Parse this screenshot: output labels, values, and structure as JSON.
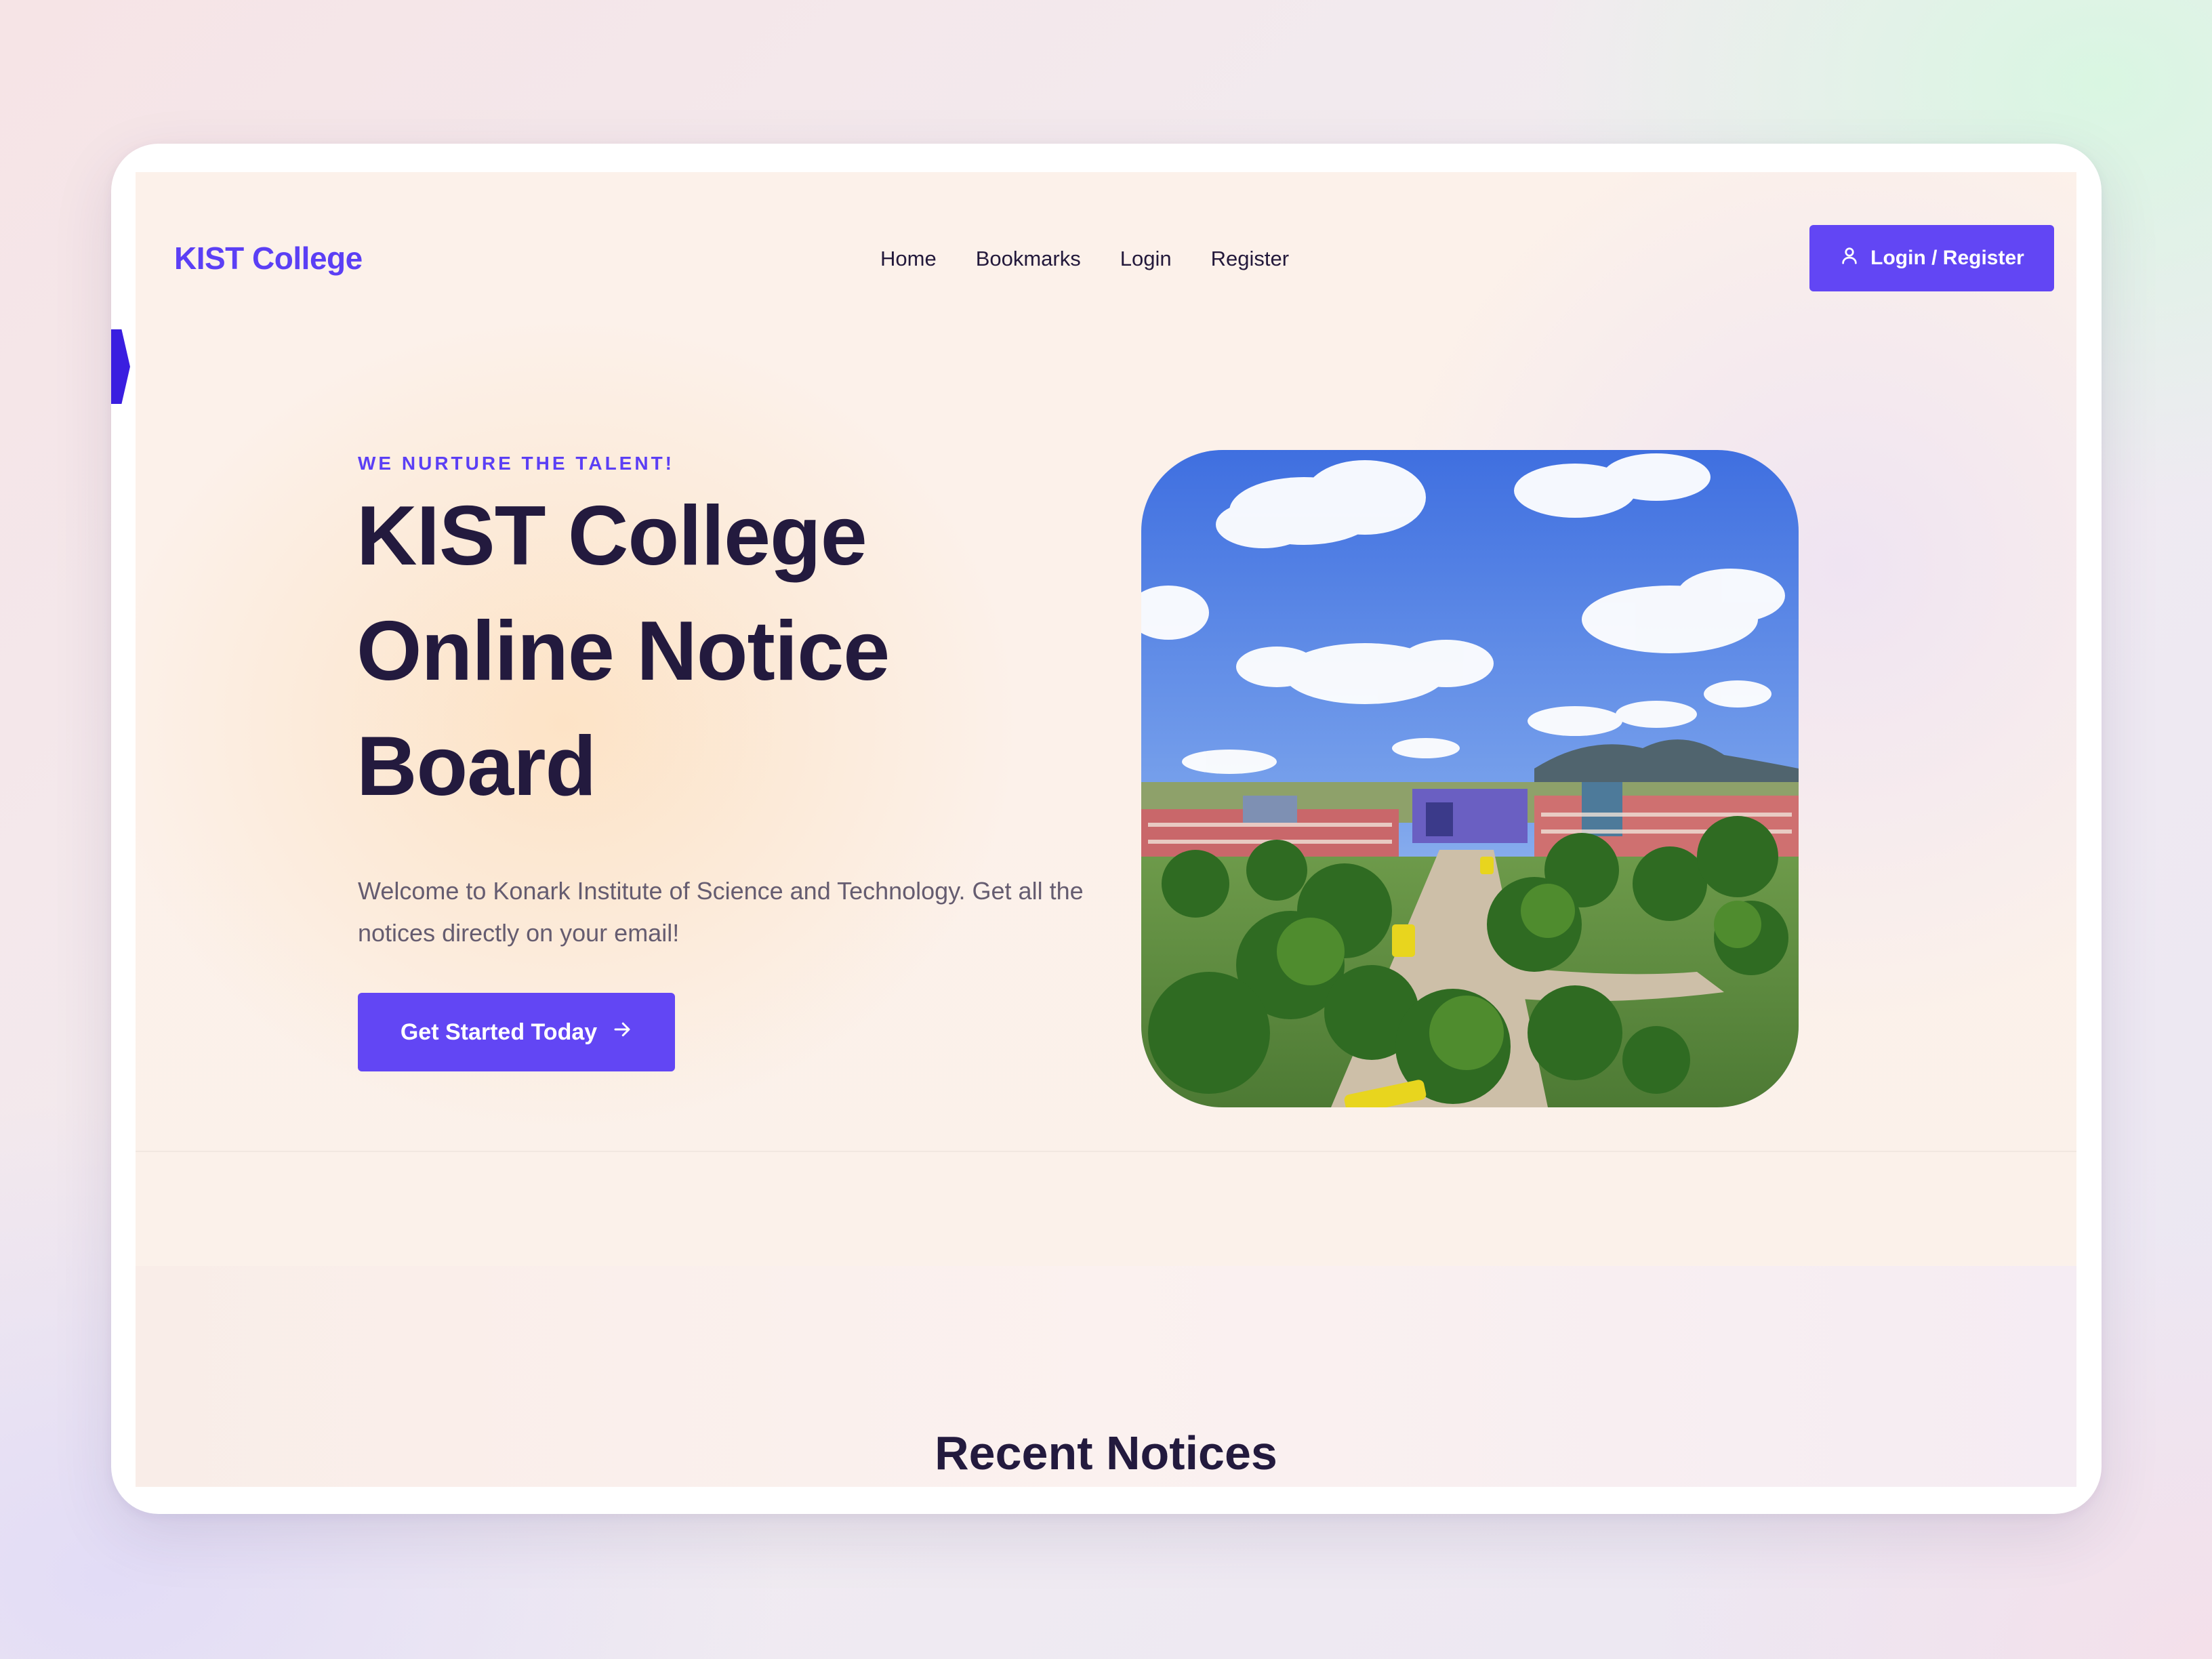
{
  "nav": {
    "brand": "KIST College",
    "links": [
      "Home",
      "Bookmarks",
      "Login",
      "Register"
    ],
    "login_button": "Login / Register"
  },
  "hero": {
    "eyebrow": "WE NURTURE THE TALENT!",
    "title_lines": [
      "KIST College",
      "Online Notice",
      "Board"
    ],
    "description": "Welcome to Konark Institute of Science and Technology. Get all the notices directly on your email!",
    "cta_label": "Get Started Today",
    "image_alt": "Aerial view of KIST College campus"
  },
  "sections": {
    "recent_notices_title": "Recent Notices"
  },
  "colors": {
    "accent": "#6246f4",
    "heading": "#231a3e",
    "body_text": "#655c70"
  }
}
